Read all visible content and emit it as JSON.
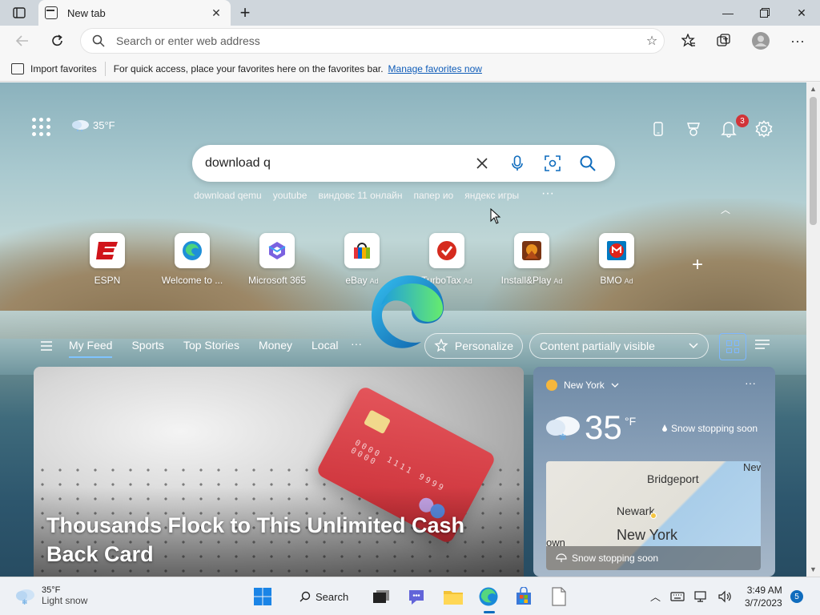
{
  "browser": {
    "tab_title": "New tab",
    "address_placeholder": "Search or enter web address"
  },
  "favorites_bar": {
    "import_label": "Import favorites",
    "message": "For quick access, place your favorites here on the favorites bar.",
    "link": "Manage favorites now"
  },
  "newtab": {
    "weather_temp": "35°F",
    "notification_count": "3",
    "search_query": "download q",
    "suggestions": [
      "download qemu",
      "youtube",
      "виндовс 11 онлайн",
      "папер ио",
      "яндекс игры"
    ],
    "quick_links": [
      {
        "label": "ESPN",
        "ad": "",
        "icon": "espn-icon"
      },
      {
        "label": "Welcome to ...",
        "ad": "",
        "icon": "edge-icon"
      },
      {
        "label": "Microsoft 365",
        "ad": "",
        "icon": "m365-icon"
      },
      {
        "label": "eBay",
        "ad": "Ad",
        "icon": "ebay-icon"
      },
      {
        "label": "TurboTax",
        "ad": "Ad",
        "icon": "turbotax-icon"
      },
      {
        "label": "Install&Play",
        "ad": "Ad",
        "icon": "installplay-icon"
      },
      {
        "label": "BMO",
        "ad": "Ad",
        "icon": "bmo-icon"
      }
    ],
    "feed_tabs": [
      "My Feed",
      "Sports",
      "Top Stories",
      "Money",
      "Local"
    ],
    "personalize_label": "Personalize",
    "content_visibility": "Content partially visible"
  },
  "hero": {
    "title": "Thousands Flock to This Unlimited Cash Back Card",
    "card_number": "0000 1111 9999 0000"
  },
  "weather_card": {
    "location": "New York",
    "temp": "35",
    "unit": "°F",
    "condition": "Snow stopping soon",
    "map_labels": {
      "city1": "Bridgeport",
      "city2": "Newark",
      "city3": "New York",
      "city4": "New",
      "city5": "own"
    },
    "map_footer": "Snow stopping soon"
  },
  "taskbar": {
    "weather_temp": "35°F",
    "weather_desc": "Light snow",
    "search_label": "Search",
    "time": "3:49 AM",
    "date": "3/7/2023",
    "notif_count": "5"
  },
  "colors": {
    "accent": "#0f6cbd",
    "badge_red": "#d13438"
  }
}
